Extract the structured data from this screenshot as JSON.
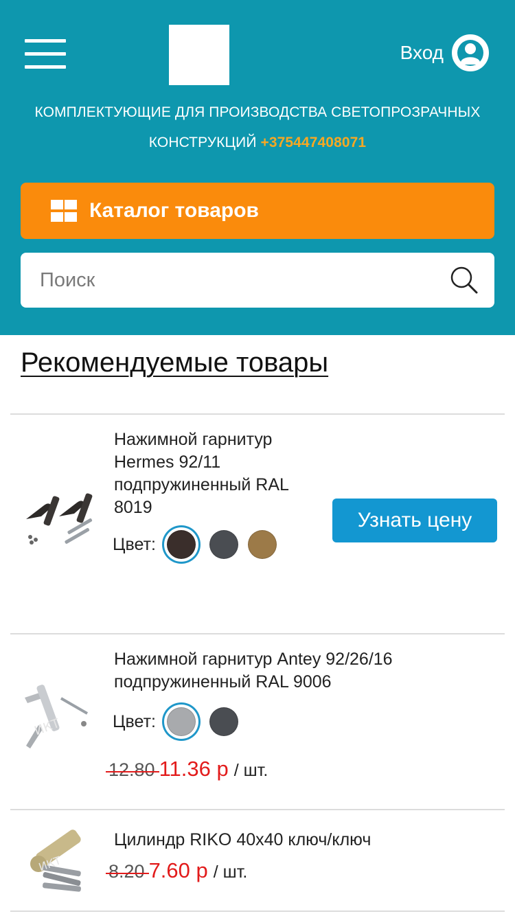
{
  "header": {
    "login_label": "Вход",
    "tagline_line1": "КОМПЛЕКТУЮЩИЕ ДЛЯ ПРОИЗВОДСТВА СВЕТОПРОЗРАЧНЫХ",
    "tagline_line2": "КОНСТРУКЦИЙ",
    "phone": "+375447408071",
    "catalog_label": "Каталог товаров",
    "search_placeholder": "Поиск"
  },
  "section": {
    "title": "Рекомендуемые товары"
  },
  "products": [
    {
      "name": "Нажимной гарнитур Hermes 92/11 подпружиненный RAL 8019",
      "color_label": "Цвет:",
      "swatches": [
        "#3a2e2b",
        "#4a4d52",
        "#9c7a48"
      ],
      "selected_swatch": 0,
      "button_label": "Узнать цену"
    },
    {
      "name": "Нажимной гарнитур Antey 92/26/16 подпружиненный RAL 9006",
      "color_label": "Цвет:",
      "swatches": [
        "#a8aaad",
        "#4a4d52"
      ],
      "selected_swatch": 0,
      "old_price": "12.80",
      "new_price": "11.36 р",
      "unit": "/ шт."
    },
    {
      "name": "Цилиндр RIKO 40x40 ключ/ключ",
      "old_price": "8.20",
      "new_price": "7.60 р",
      "unit": "/ шт."
    }
  ],
  "colors": {
    "header_bg": "#0e97ae",
    "catalog_bg": "#fa8b0c",
    "phone": "#f7a823",
    "price_red": "#e21b1b",
    "button_blue": "#1397d1"
  },
  "icons": [
    "menu-icon",
    "user-icon",
    "grid-icon",
    "search-icon"
  ]
}
